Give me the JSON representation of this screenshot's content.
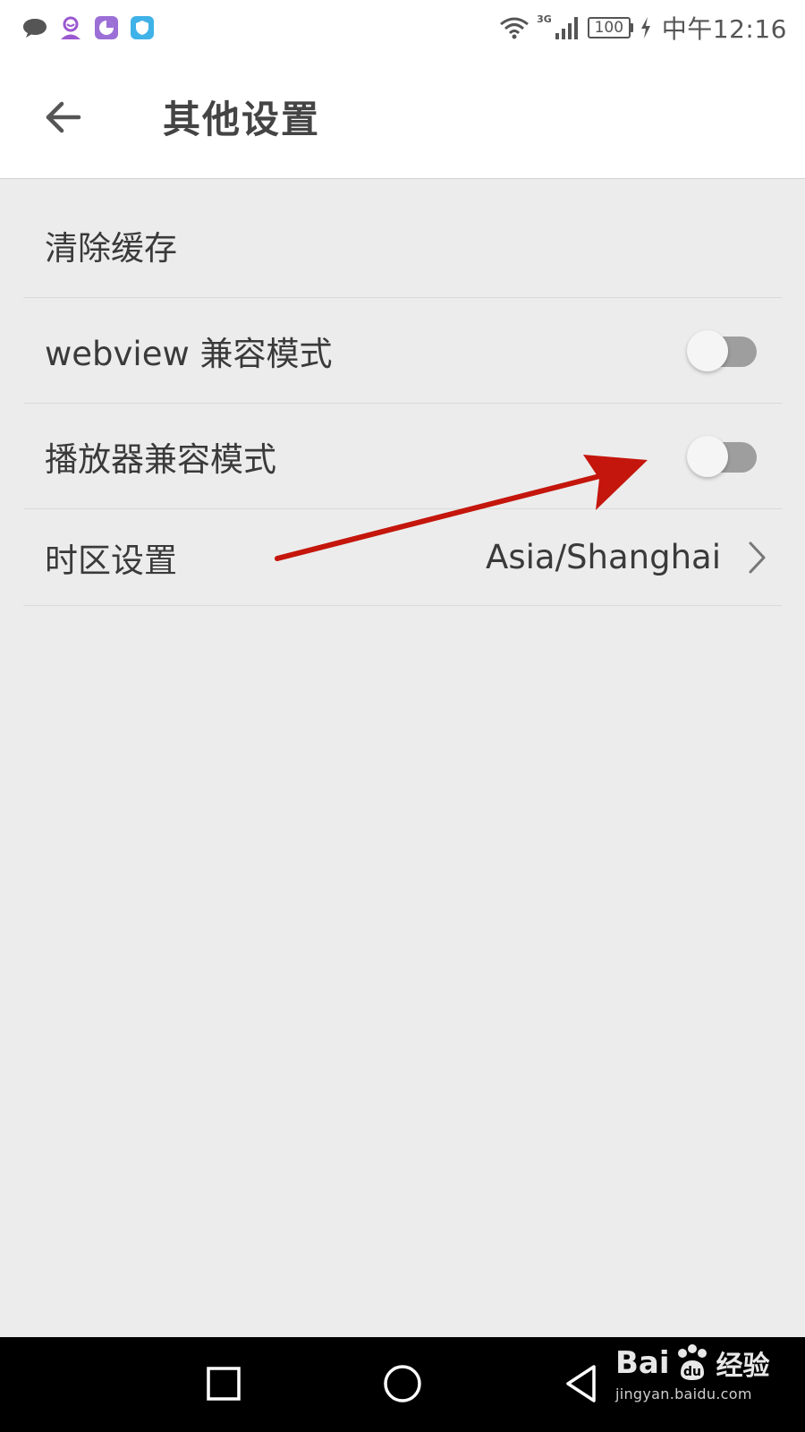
{
  "status_bar": {
    "notification_icons": [
      "chat-bubble-icon",
      "person-app-icon",
      "pie-chart-app-icon",
      "shield-app-icon"
    ],
    "network_type": "3G",
    "battery_level": "100",
    "time": "中午12:16"
  },
  "toolbar": {
    "title": "其他设置"
  },
  "settings": {
    "clear_cache_label": "清除缓存",
    "webview_label": "webview 兼容模式",
    "webview_enabled": false,
    "player_label": "播放器兼容模式",
    "player_enabled": false,
    "timezone_label": "时区设置",
    "timezone_value": "Asia/Shanghai"
  },
  "annotation": {
    "color": "#c4160c"
  },
  "watermark": {
    "brand": "Bai",
    "brand_suffix": "经验",
    "url": "jingyan.baidu.com"
  },
  "colors": {
    "toggle_off_track": "#9e9e9e",
    "toggle_knob": "#f5f5f5",
    "page_background": "#ececec"
  }
}
